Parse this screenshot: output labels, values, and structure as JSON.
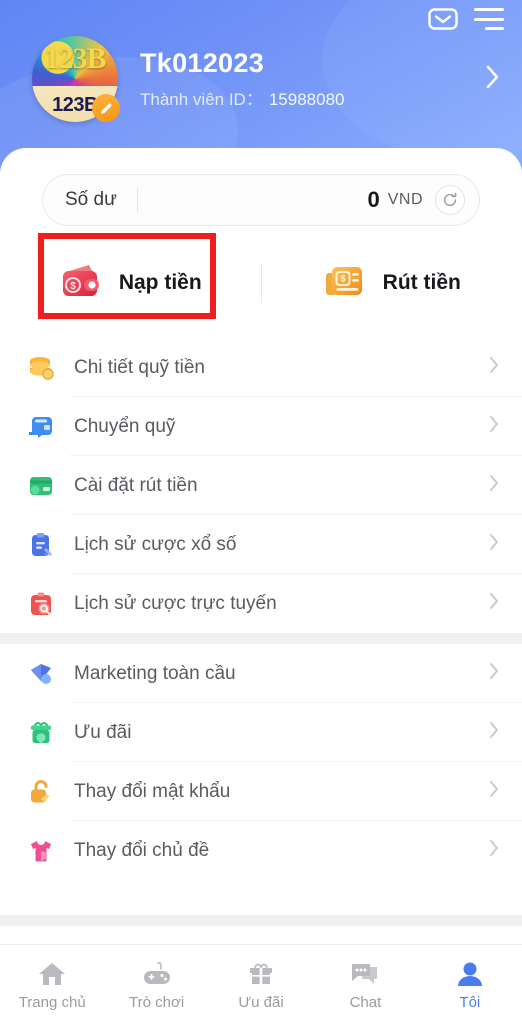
{
  "header": {
    "mail_icon": "envelope-icon",
    "menu_icon": "hamburger-menu-icon",
    "avatar": {
      "logo_mark": "123B",
      "brand_text": "123B",
      "edit_badge_icon": "pencil-edit-icon"
    },
    "user_name": "Tk012023",
    "member_id_label": "Thành viên ID：",
    "member_id_value": "15988080",
    "arrow_icon": "chevron-right-icon",
    "gradient_start": "#5f86f5",
    "gradient_end": "#8fb0fd"
  },
  "balance": {
    "label": "Số dư",
    "amount": "0",
    "currency": "VND",
    "refresh_icon": "refresh-icon"
  },
  "actions": [
    {
      "label": "Nạp tiền",
      "icon": "wallet-deposit-icon",
      "color": "#e8384f",
      "highlighted": true
    },
    {
      "label": "Rút tiền",
      "icon": "withdraw-card-icon",
      "color": "#f59b1e",
      "highlighted": false
    }
  ],
  "annotation": {
    "color": "#f01f1f",
    "target": "Nạp tiền"
  },
  "menu_groups": [
    {
      "items": [
        {
          "label": "Chi tiết quỹ tiền",
          "icon": "coin-stack-icon",
          "color": "#f2a93b"
        },
        {
          "label": "Chuyển quỹ",
          "icon": "wallet-transfer-icon",
          "color": "#3d8ef0"
        },
        {
          "label": "Cài đặt rút tiền",
          "icon": "bank-card-icon",
          "color": "#2fc07a"
        },
        {
          "label": "Lịch sử cược xổ số",
          "icon": "clipboard-pen-icon",
          "color": "#4a74e8"
        },
        {
          "label": "Lịch sử cược trực tuyến",
          "icon": "clipboard-search-icon",
          "color": "#ef5350"
        }
      ]
    },
    {
      "items": [
        {
          "label": "Marketing toàn cầu",
          "icon": "megaphone-icon",
          "color": "#4a74e8"
        },
        {
          "label": "Ưu đãi",
          "icon": "gift-box-icon",
          "color": "#2fc07a"
        },
        {
          "label": "Thay đổi mật khẩu",
          "icon": "padlock-open-icon",
          "color": "#f2a93b"
        },
        {
          "label": "Thay đổi chủ đề",
          "icon": "tshirt-icon",
          "color": "#ef4f91"
        }
      ]
    }
  ],
  "bottom_nav": {
    "active_color": "#4a7cf0",
    "inactive_color": "#9a9aa0",
    "items": [
      {
        "label": "Trang chủ",
        "icon": "home-icon",
        "active": false
      },
      {
        "label": "Trò chơi",
        "icon": "gamepad-icon",
        "active": false
      },
      {
        "label": "Ưu đãi",
        "icon": "gift-icon",
        "active": false
      },
      {
        "label": "Chat",
        "icon": "chat-bubble-icon",
        "active": false
      },
      {
        "label": "Tôi",
        "icon": "user-profile-icon",
        "active": true
      }
    ]
  }
}
